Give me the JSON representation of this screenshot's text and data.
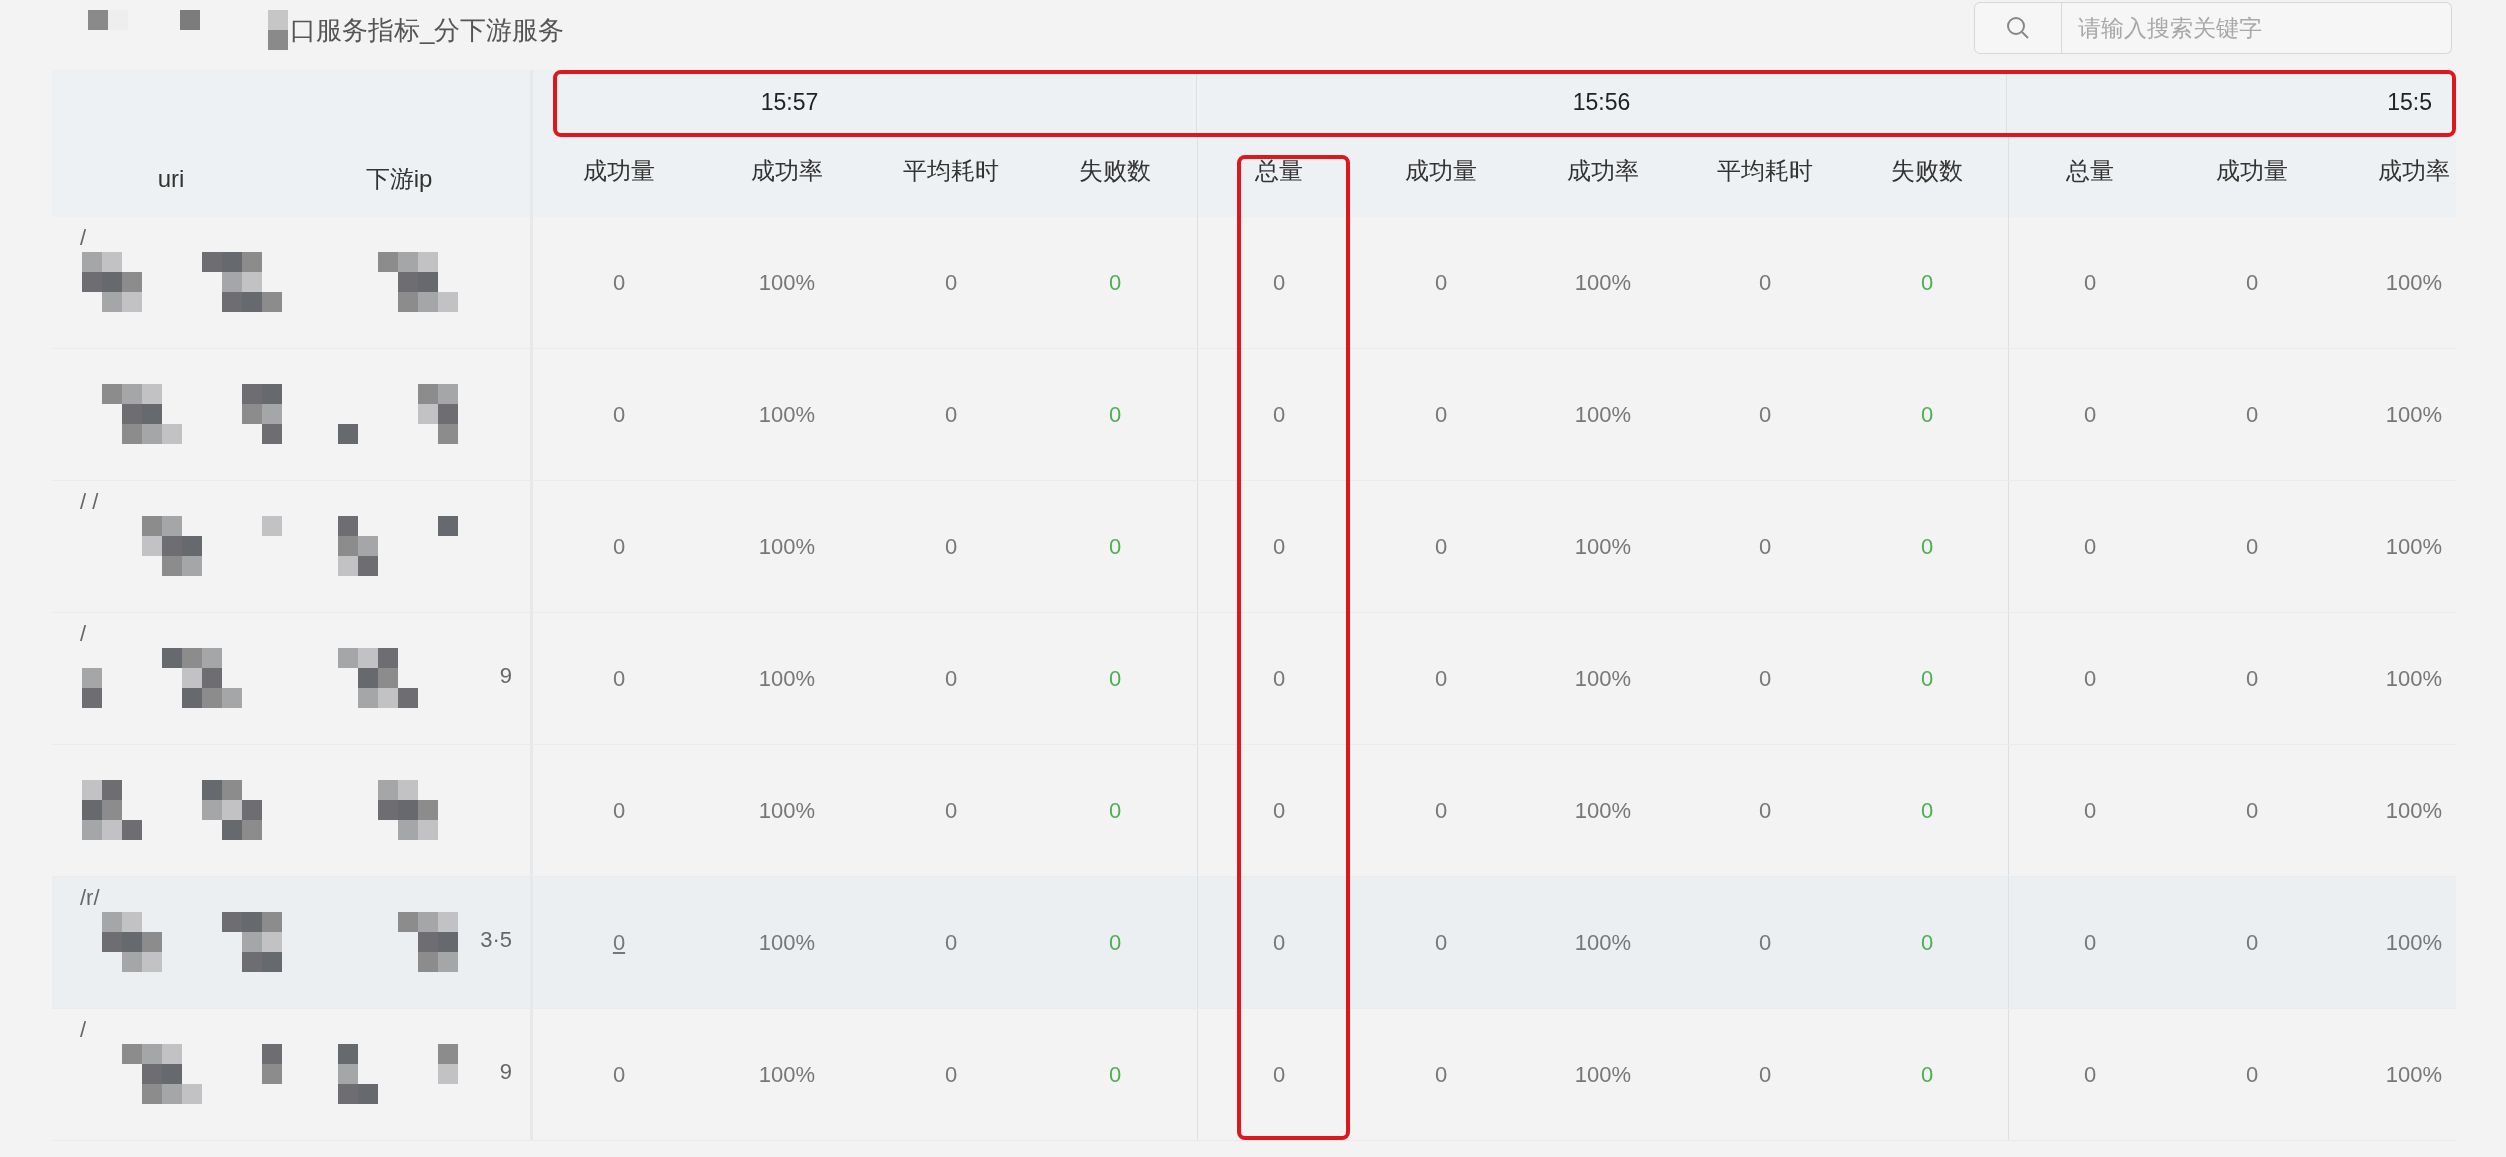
{
  "title": "口服务指标_分下游服务",
  "search": {
    "placeholder": "请输入搜索关键字"
  },
  "table": {
    "left_columns": [
      "uri",
      "下游ip"
    ],
    "groups": [
      {
        "time": "15:57",
        "columns": [
          {
            "label": "成功量",
            "kind": "count"
          },
          {
            "label": "成功率",
            "kind": "rate"
          },
          {
            "label": "平均耗时",
            "kind": "count"
          },
          {
            "label": "失败数",
            "kind": "fail"
          }
        ]
      },
      {
        "time": "15:56",
        "columns": [
          {
            "label": "总量",
            "kind": "count",
            "boxed": true
          },
          {
            "label": "成功量",
            "kind": "count"
          },
          {
            "label": "成功率",
            "kind": "rate"
          },
          {
            "label": "平均耗时",
            "kind": "count"
          },
          {
            "label": "失败数",
            "kind": "fail"
          }
        ]
      },
      {
        "time": "15:5",
        "columns": [
          {
            "label": "总量",
            "kind": "count"
          },
          {
            "label": "成功量",
            "kind": "count"
          },
          {
            "label": "成功率",
            "kind": "rate"
          }
        ]
      }
    ],
    "rows": [
      {
        "uri": "/",
        "ip": "",
        "highlighted": false,
        "linked": false,
        "values": [
          [
            "0",
            "100%",
            "0",
            "0"
          ],
          [
            "0",
            "0",
            "100%",
            "0",
            "0"
          ],
          [
            "0",
            "0",
            "100%"
          ]
        ]
      },
      {
        "uri": "",
        "ip": "",
        "highlighted": false,
        "linked": false,
        "values": [
          [
            "0",
            "100%",
            "0",
            "0"
          ],
          [
            "0",
            "0",
            "100%",
            "0",
            "0"
          ],
          [
            "0",
            "0",
            "100%"
          ]
        ]
      },
      {
        "uri": "/ /",
        "ip": "",
        "highlighted": false,
        "linked": false,
        "values": [
          [
            "0",
            "100%",
            "0",
            "0"
          ],
          [
            "0",
            "0",
            "100%",
            "0",
            "0"
          ],
          [
            "0",
            "0",
            "100%"
          ]
        ]
      },
      {
        "uri": "/",
        "ip": "9",
        "highlighted": false,
        "linked": false,
        "values": [
          [
            "0",
            "100%",
            "0",
            "0"
          ],
          [
            "0",
            "0",
            "100%",
            "0",
            "0"
          ],
          [
            "0",
            "0",
            "100%"
          ]
        ]
      },
      {
        "uri": "",
        "ip": "",
        "highlighted": false,
        "linked": false,
        "values": [
          [
            "0",
            "100%",
            "0",
            "0"
          ],
          [
            "0",
            "0",
            "100%",
            "0",
            "0"
          ],
          [
            "0",
            "0",
            "100%"
          ]
        ]
      },
      {
        "uri": "/r/",
        "ip": "3·5",
        "highlighted": true,
        "linked": true,
        "values": [
          [
            "0",
            "100%",
            "0",
            "0"
          ],
          [
            "0",
            "0",
            "100%",
            "0",
            "0"
          ],
          [
            "0",
            "0",
            "100%"
          ]
        ]
      },
      {
        "uri": "/",
        "ip": "9",
        "highlighted": false,
        "linked": false,
        "values": [
          [
            "0",
            "100%",
            "0",
            "0"
          ],
          [
            "0",
            "0",
            "100%",
            "0",
            "0"
          ],
          [
            "0",
            "0",
            "100%"
          ]
        ]
      }
    ]
  },
  "time_row_boxed": true
}
